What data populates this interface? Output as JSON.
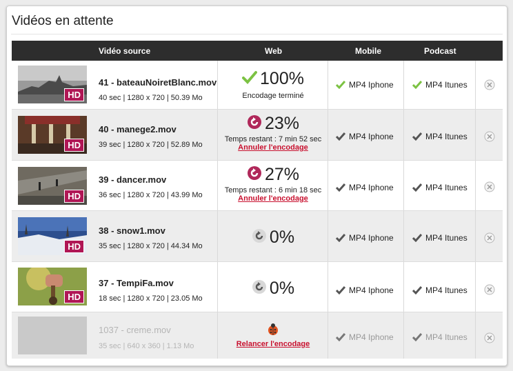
{
  "title": "Vidéos en attente",
  "columns": {
    "source": "Vidéo source",
    "web": "Web",
    "mobile": "Mobile",
    "podcast": "Podcast"
  },
  "hd_label": "HD",
  "rows": [
    {
      "name": "41 - bateauNoiretBlanc.mov",
      "meta": "40 sec | 1280 x 720 | 50.39 Mo",
      "percent": "100%",
      "web_line1": "Encodage terminé",
      "web_link": "",
      "mobile": "MP4 Iphone",
      "podcast": "MP4 Itunes"
    },
    {
      "name": "40 - manege2.mov",
      "meta": "39 sec | 1280 x 720 | 52.89 Mo",
      "percent": "23%",
      "web_line1": "Temps restant : 7 min 52 sec",
      "web_link": "Annuler l'encodage",
      "mobile": "MP4 Iphone",
      "podcast": "MP4 Itunes"
    },
    {
      "name": "39 - dancer.mov",
      "meta": "36 sec | 1280 x 720 | 43.99 Mo",
      "percent": "27%",
      "web_line1": "Temps restant : 6 min 18 sec",
      "web_link": "Annuler l'encodage",
      "mobile": "MP4 Iphone",
      "podcast": "MP4 Itunes"
    },
    {
      "name": "38 - snow1.mov",
      "meta": "35 sec | 1280 x 720 | 44.34 Mo",
      "percent": "0%",
      "web_line1": "",
      "web_link": "",
      "mobile": "MP4 Iphone",
      "podcast": "MP4 Itunes"
    },
    {
      "name": "37 - TempiFa.mov",
      "meta": "18 sec | 1280 x 720 | 23.05 Mo",
      "percent": "0%",
      "web_line1": "",
      "web_link": "",
      "mobile": "MP4 Iphone",
      "podcast": "MP4 Itunes"
    },
    {
      "name": "1037 - creme.mov",
      "meta": "35 sec | 640 x 360 | 1.13 Mo",
      "percent": "",
      "web_line1": "",
      "web_link": "Relancer l'encodage",
      "mobile": "MP4 Iphone",
      "podcast": "MP4 Itunes"
    }
  ],
  "colors": {
    "header": "#2d2d2d",
    "hd_badge": "#b01655",
    "link": "#c8102e",
    "check_done": "#7cc243",
    "progress_icon": "#b0285a",
    "pending_icon": "#555555"
  }
}
